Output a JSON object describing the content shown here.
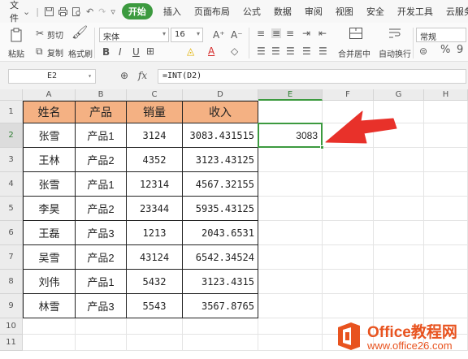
{
  "menubar": {
    "file": "文件",
    "tabs": [
      "开始",
      "插入",
      "页面布局",
      "公式",
      "数据",
      "审阅",
      "视图",
      "安全",
      "开发工具",
      "云服务"
    ],
    "active_tab": "开始",
    "quick_icons": [
      "save-icon",
      "print-icon",
      "print-preview-icon",
      "undo-icon",
      "redo-icon",
      "dropdown-icon"
    ]
  },
  "ribbon": {
    "paste": "粘贴",
    "cut": "剪切",
    "copy": "复制",
    "format_painter": "格式刷",
    "font_name": "宋体",
    "font_size": "16",
    "bold": "B",
    "italic": "I",
    "underline": "U",
    "merge": "合并居中",
    "wrap": "自动换行",
    "number_format": "常规",
    "percent": "%",
    "thousands": "9"
  },
  "formula_bar": {
    "name_box": "E2",
    "fx": "fx",
    "formula": "=INT(D2)"
  },
  "grid": {
    "columns": [
      "A",
      "B",
      "C",
      "D",
      "E",
      "F",
      "G",
      "H"
    ],
    "selected_column": "E",
    "rows": [
      "1",
      "2",
      "3",
      "4",
      "5",
      "6",
      "7",
      "8",
      "9",
      "10",
      "11"
    ],
    "selected_row": "2",
    "headers": [
      "姓名",
      "产品",
      "销量",
      "收入"
    ],
    "data": [
      [
        "张雪",
        "产品1",
        "3124",
        "3083.431515"
      ],
      [
        "王林",
        "产品2",
        "4352",
        "3123.43125"
      ],
      [
        "张雪",
        "产品1",
        "12314",
        "4567.32155"
      ],
      [
        "李昊",
        "产品2",
        "23344",
        "5935.43125"
      ],
      [
        "王磊",
        "产品3",
        "1213",
        "2043.6531"
      ],
      [
        "吴雪",
        "产品2",
        "43124",
        "6542.34524"
      ],
      [
        "刘伟",
        "产品1",
        "5432",
        "3123.4315"
      ],
      [
        "林雪",
        "产品3",
        "5543",
        "3567.8765"
      ]
    ],
    "active_cell": {
      "ref": "E2",
      "value": "3083"
    }
  },
  "colors": {
    "accent": "#3c9a3f",
    "header_fill": "#f4b183",
    "arrow": "#e8312a",
    "watermark": "#e8531f"
  },
  "watermark": {
    "title": "Office教程网",
    "url": "www.office26.com"
  }
}
